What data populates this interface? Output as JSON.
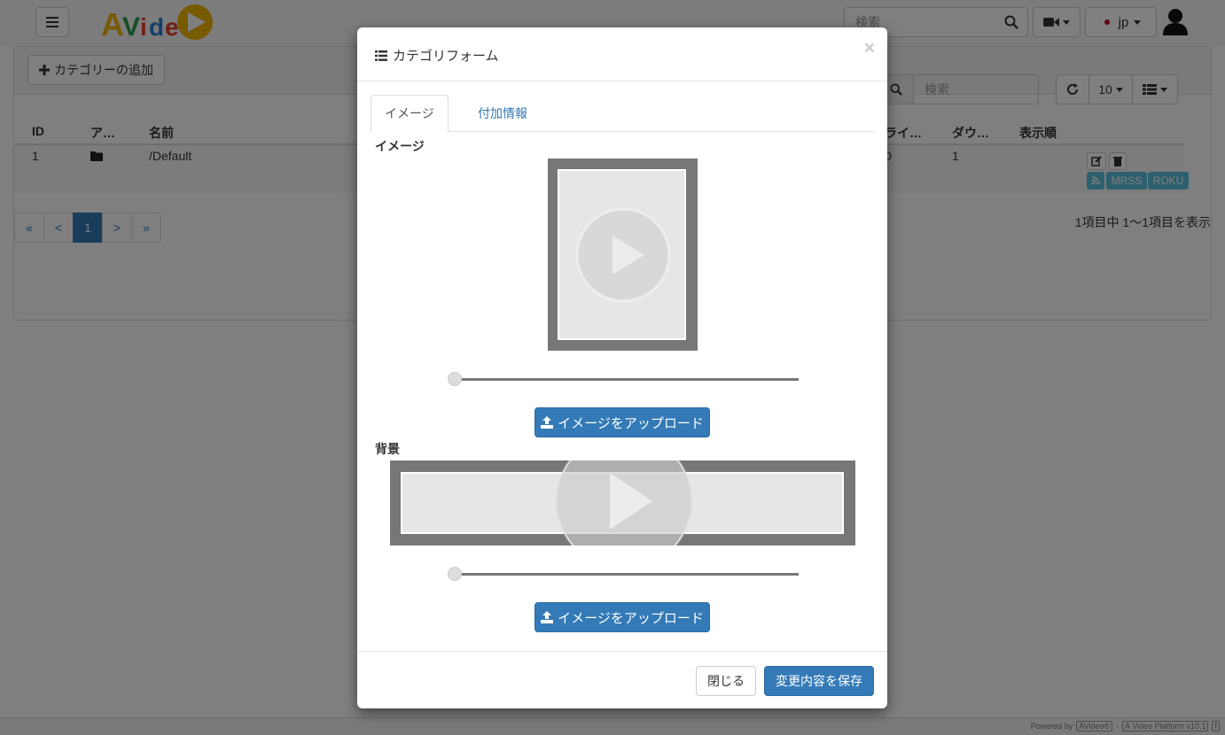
{
  "navbar": {
    "logo_text": "AVideo",
    "search_placeholder": "検索",
    "language": "jp"
  },
  "toolbar": {
    "add_category_label": "カテゴリーの追加"
  },
  "grid": {
    "search_placeholder": "検索",
    "page_size": "10",
    "columns": [
      "ID",
      "ア…",
      "名前",
      "ライ…",
      "ダウ…",
      "表示順"
    ],
    "rows": [
      {
        "id": "1",
        "name": "/Default",
        "live": "0",
        "downloads": "1"
      }
    ],
    "row_badges": {
      "mrss": "MRSS",
      "roku": "ROKU"
    },
    "pager": {
      "first": "«",
      "prev": "<",
      "current": "1",
      "next": ">",
      "last": "»"
    },
    "info": "1項目中 1〜1項目を表示"
  },
  "footer": {
    "powered_by": "Powered by",
    "brand": "AVideo®",
    "platform": "A Video Platform v10.1"
  },
  "modal": {
    "title": "カテゴリフォーム",
    "close": "×",
    "tabs": [
      {
        "label": "イメージ",
        "active": true
      },
      {
        "label": "付加情報",
        "active": false
      }
    ],
    "image_section_label": "イメージ",
    "background_section_label": "背景",
    "upload_label": "イメージをアップロード",
    "image_zoom": 0,
    "background_zoom": 0,
    "close_button": "閉じる",
    "save_button": "変更内容を保存"
  },
  "colors": {
    "primary": "#337ab7",
    "badge": "#5bc0de",
    "logo_yellow": "#f0b400"
  }
}
